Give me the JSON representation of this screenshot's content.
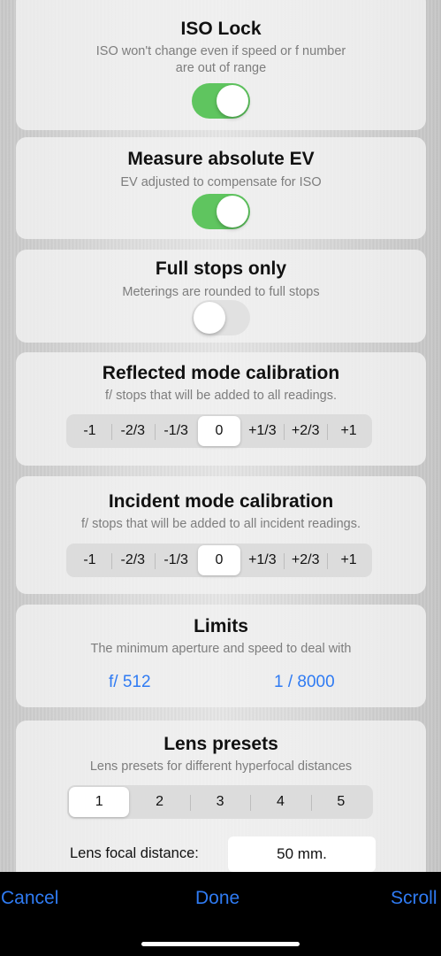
{
  "iso_lock": {
    "title": "ISO Lock",
    "subtitle_line1": "ISO won't change even if speed or f number",
    "subtitle_line2": "are out of range",
    "enabled": true
  },
  "absolute_ev": {
    "title": "Measure absolute EV",
    "subtitle": "EV adjusted to compensate for ISO",
    "enabled": true
  },
  "full_stops": {
    "title": "Full stops only",
    "subtitle": "Meterings are rounded to full stops",
    "enabled": false
  },
  "reflected": {
    "title": "Reflected mode calibration",
    "subtitle": "f/ stops that will be added to all readings.",
    "options": [
      "-1",
      "-2/3",
      "-1/3",
      "0",
      "+1/3",
      "+2/3",
      "+1"
    ],
    "selected": "0"
  },
  "incident": {
    "title": "Incident mode calibration",
    "subtitle": "f/ stops that will be added to all incident readings.",
    "options": [
      "-1",
      "-2/3",
      "-1/3",
      "0",
      "+1/3",
      "+2/3",
      "+1"
    ],
    "selected": "0"
  },
  "limits": {
    "title": "Limits",
    "subtitle": "The minimum aperture and speed to deal with",
    "aperture": "f/ 512",
    "speed": "1 / 8000"
  },
  "lens_presets": {
    "title": "Lens presets",
    "subtitle": "Lens presets for different hyperfocal distances",
    "options": [
      "1",
      "2",
      "3",
      "4",
      "5"
    ],
    "selected": "1",
    "focal_label": "Lens focal distance:",
    "focal_value": "50 mm."
  },
  "toolbar": {
    "cancel": "Cancel",
    "done": "Done",
    "scroll": "Scroll"
  },
  "colors": {
    "accent": "#2f7bf3",
    "toggle_on": "#5fc55f"
  }
}
